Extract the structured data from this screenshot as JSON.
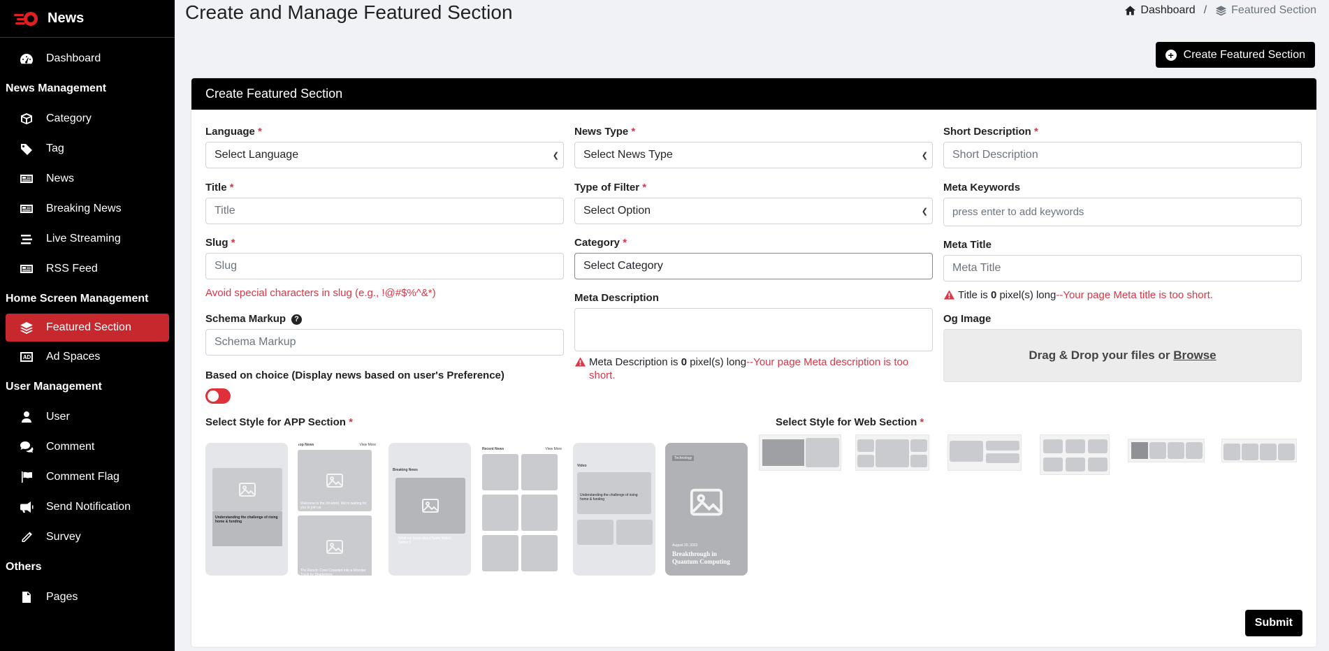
{
  "brand": {
    "name": "News"
  },
  "sidebar": {
    "dashboard": "Dashboard",
    "sections": [
      {
        "heading": "News Management",
        "items": [
          "Category",
          "Tag",
          "News",
          "Breaking News",
          "Live Streaming",
          "RSS Feed"
        ]
      },
      {
        "heading": "Home Screen Management",
        "items": [
          "Featured Section",
          "Ad Spaces"
        ]
      },
      {
        "heading": "User Management",
        "items": [
          "User",
          "Comment",
          "Comment Flag",
          "Send Notification",
          "Survey"
        ]
      },
      {
        "heading": "Others",
        "items": [
          "Pages"
        ]
      }
    ],
    "active_item": "Featured Section"
  },
  "header": {
    "title": "Create and Manage Featured Section",
    "breadcrumb": {
      "home": "Dashboard",
      "separator": "/",
      "current": "Featured Section"
    },
    "create_button": "Create Featured Section"
  },
  "form": {
    "card_title": "Create Featured Section",
    "language": {
      "label": "Language",
      "value": "Select Language"
    },
    "title": {
      "label": "Title",
      "placeholder": "Title"
    },
    "slug": {
      "label": "Slug",
      "placeholder": "Slug",
      "error": "Avoid special characters in slug (e.g., !@#$%^&*)"
    },
    "schema": {
      "label": "Schema Markup",
      "placeholder": "Schema Markup"
    },
    "based_on_choice": {
      "label": "Based on choice (Display news based on user's Preference)"
    },
    "news_type": {
      "label": "News Type",
      "value": "Select News Type"
    },
    "type_of_filter": {
      "label": "Type of Filter",
      "value": "Select Option"
    },
    "category": {
      "label": "Category",
      "placeholder": "Select Category"
    },
    "meta_description": {
      "label": "Meta Description",
      "note_prefix": "Meta Description is",
      "count": "0",
      "note_suffix": "pixel(s) long",
      "warning": "--Your page Meta description is too short."
    },
    "short_description": {
      "label": "Short Description",
      "placeholder": "Short Description"
    },
    "meta_keywords": {
      "label": "Meta Keywords",
      "placeholder": "press enter to add keywords"
    },
    "meta_title": {
      "label": "Meta Title",
      "placeholder": "Meta Title",
      "note_prefix": "Title is",
      "count": "0",
      "note_suffix": "pixel(s) long",
      "warning": "--Your page Meta title is too short."
    },
    "og_image": {
      "label": "Og Image",
      "drop_text": "Drag & Drop your files or",
      "browse": "Browse"
    },
    "app_style_label": "Select Style for APP Section",
    "web_style_label": "Select Style for Web Section",
    "app_thumb_texts": {
      "t1": "Understanding the challenge of rising home & funding",
      "t2_head": "Top News",
      "t2_view": "View More",
      "t2_cap1": "Welcome to the 3d world. We're waiting for you to join us",
      "t2_cap2": "The Ranch: Crew Crowded Into a Monster Truck by Shadertoys",
      "t3_head": "Breaking News",
      "t3_cap": "What we know about Apple Watch Series 9",
      "t4_head": "Recent News",
      "t4_view": "View More",
      "t5_head": "Video",
      "t5_cap": "Understanding the challenge of rising home & funding",
      "t6_tag": "Technology",
      "t6_date": "August 20, 2023",
      "t6_cap": "Breakthrough in Quantum Computing"
    },
    "submit": "Submit"
  },
  "colors": {
    "accent": "#c7282e",
    "sidebar_bg": "#000000",
    "card_header_bg": "#000000",
    "error": "#dc3545"
  }
}
